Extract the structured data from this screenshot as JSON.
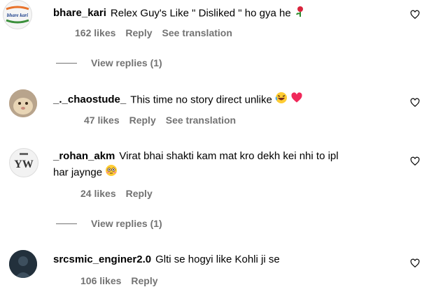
{
  "comments": [
    {
      "username": "bhare_kari",
      "text": "Relex Guy's Like \" Disliked \" ho gya he",
      "likes": "162 likes",
      "reply": "Reply",
      "translation": "See translation",
      "avatar_text": "bhare kari",
      "view_replies": "View replies (1)"
    },
    {
      "username": "_._chaostude_",
      "text": "This time no story direct unlike",
      "likes": "47 likes",
      "reply": "Reply",
      "translation": "See translation"
    },
    {
      "username": "_rohan_akm",
      "text": "Virat bhai shakti kam mat kro dekh kei nhi to ipl",
      "text2": "har jaynge",
      "likes": "24 likes",
      "reply": "Reply",
      "avatar_text": "YW",
      "view_replies": "View replies (1)"
    },
    {
      "username": "srcsmic_enginer2.0",
      "text": "Glti se hogyi like Kohli ji se",
      "likes": "106 likes",
      "reply": "Reply"
    }
  ],
  "colors": {
    "meta": "#737373",
    "heart_emoji": "#f0285a"
  }
}
